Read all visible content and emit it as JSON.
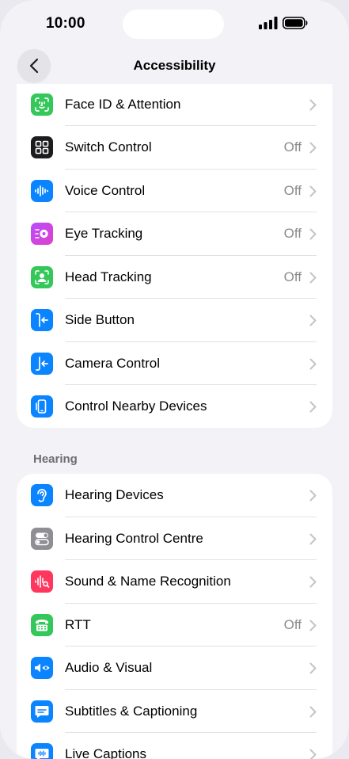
{
  "status": {
    "time": "10:00"
  },
  "nav": {
    "title": "Accessibility"
  },
  "section1": {
    "rows": [
      {
        "label": "Face ID & Attention",
        "value": "",
        "icon": "face-id-icon",
        "color": "#34c759"
      },
      {
        "label": "Switch Control",
        "value": "Off",
        "icon": "switch-control-icon",
        "color": "#1c1c1e"
      },
      {
        "label": "Voice Control",
        "value": "Off",
        "icon": "voice-control-icon",
        "color": "#0a84ff"
      },
      {
        "label": "Eye Tracking",
        "value": "Off",
        "icon": "eye-tracking-icon",
        "color": "#c644fc"
      },
      {
        "label": "Head Tracking",
        "value": "Off",
        "icon": "head-tracking-icon",
        "color": "#34c759"
      },
      {
        "label": "Side Button",
        "value": "",
        "icon": "side-button-icon",
        "color": "#0a84ff"
      },
      {
        "label": "Camera Control",
        "value": "",
        "icon": "camera-control-icon",
        "color": "#0a84ff"
      },
      {
        "label": "Control Nearby Devices",
        "value": "",
        "icon": "nearby-devices-icon",
        "color": "#0a84ff"
      }
    ]
  },
  "section2": {
    "header": "Hearing",
    "rows": [
      {
        "label": "Hearing Devices",
        "value": "",
        "icon": "ear-icon",
        "color": "#0a84ff"
      },
      {
        "label": "Hearing Control Centre",
        "value": "",
        "icon": "toggles-icon",
        "color": "#8e8e93"
      },
      {
        "label": "Sound & Name Recognition",
        "value": "",
        "icon": "sound-recognition-icon",
        "color": "#ff375f"
      },
      {
        "label": "RTT",
        "value": "Off",
        "icon": "rtt-phone-icon",
        "color": "#34c759"
      },
      {
        "label": "Audio & Visual",
        "value": "",
        "icon": "audio-visual-icon",
        "color": "#0a84ff"
      },
      {
        "label": "Subtitles & Captioning",
        "value": "",
        "icon": "subtitles-icon",
        "color": "#0a84ff"
      },
      {
        "label": "Live Captions",
        "value": "",
        "icon": "live-captions-icon",
        "color": "#0a84ff"
      }
    ]
  }
}
